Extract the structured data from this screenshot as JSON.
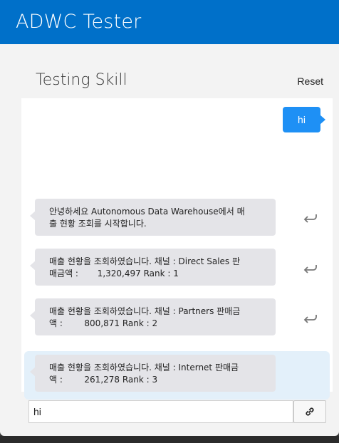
{
  "app": {
    "title": "ADWC Tester"
  },
  "skill": {
    "title": "Testing Skill",
    "reset_label": "Reset"
  },
  "conversation": {
    "user_message": "hi",
    "bot_messages": [
      {
        "text": "안녕하세요 Autonomous Data Warehouse에서 매\n출 현황 조회를 시작합니다.",
        "highlighted": false
      },
      {
        "text": "매출 현황을 조회하였습니다. 채널 : Direct Sales 판\n매금액 :       1,320,497 Rank : 1",
        "highlighted": false
      },
      {
        "text": "매출 현황을 조회하였습니다. 채널 : Partners 판매금\n액 :        800,871 Rank : 2",
        "highlighted": false
      },
      {
        "text": "매출 현황을 조회하였습니다. 채널 : Internet 판매금\n액 :        261,278 Rank : 3",
        "highlighted": true
      }
    ]
  },
  "input": {
    "value": "hi"
  },
  "icons": {
    "replay": "replay-icon",
    "link": "link-icon"
  },
  "colors": {
    "header": "#0070c9",
    "user_bubble": "#1e90f5",
    "highlight_row": "#e3f0fa"
  }
}
